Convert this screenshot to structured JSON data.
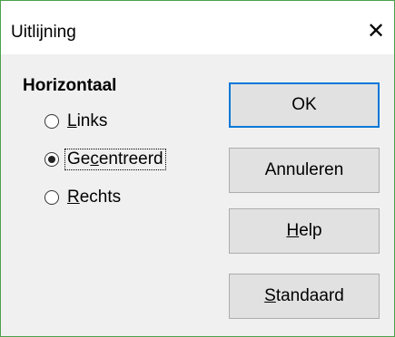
{
  "window": {
    "title": "Uitlijning",
    "close_glyph": "✕"
  },
  "alignment_group": {
    "heading": "Horizontaal",
    "options": [
      {
        "mnemonic": "L",
        "rest": "inks",
        "checked": false
      },
      {
        "mnemonic": "",
        "rest": "Gecentreerd",
        "checked": true,
        "prefix": "Ge",
        "mnemonic2": "c",
        "suffix": "entreerd"
      },
      {
        "mnemonic": "R",
        "rest": "echts",
        "checked": false
      }
    ]
  },
  "buttons": {
    "ok": {
      "label": "OK"
    },
    "cancel": {
      "label": "Annuleren"
    },
    "help": {
      "mnemonic": "H",
      "rest": "elp"
    },
    "default": {
      "mnemonic": "S",
      "rest": "tandaard"
    }
  },
  "colors": {
    "accent": "#0078d7",
    "window_border": "#4ca14c"
  }
}
